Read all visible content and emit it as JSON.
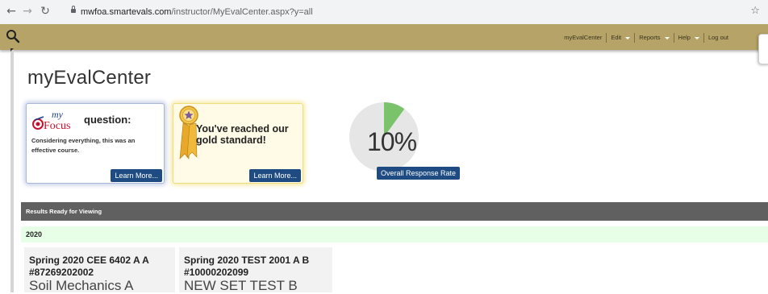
{
  "browser": {
    "url_host": "mwfoa.smartevals.com",
    "url_path": "/instructor/MyEvalCenter.aspx?y=all"
  },
  "topbar": {
    "menu": [
      {
        "label": "myEvalCenter",
        "has_caret": false
      },
      {
        "label": "Edit",
        "has_caret": true
      },
      {
        "label": "Reports",
        "has_caret": true
      },
      {
        "label": "Help",
        "has_caret": true
      },
      {
        "label": "Log out",
        "has_caret": false
      }
    ],
    "bg_color": "#b5a367"
  },
  "page_title": "myEvalCenter",
  "myfocus_card": {
    "logo_my": "my",
    "logo_focus": "Focus",
    "title": "question:",
    "text": "Considering everything, this was an effective course.",
    "button": "Learn More..."
  },
  "gold_card": {
    "title": "You've reached our gold standard!",
    "button": "Learn More..."
  },
  "response_rate": {
    "value_text": "10%",
    "fraction": 0.1,
    "button": "Overall Response Rate",
    "fill_color": "#7ac36a",
    "track_color": "#e6e6e6"
  },
  "results": {
    "header": "Results Ready for Viewing",
    "year": "2020",
    "courses": [
      {
        "title": "Spring 2020 CEE 6402 A A",
        "number": "#87269202002",
        "name": "Soil Mechanics A"
      },
      {
        "title": "Spring 2020 TEST 2001 A B",
        "number": "#10000202099",
        "name": "NEW SET TEST B"
      }
    ]
  }
}
